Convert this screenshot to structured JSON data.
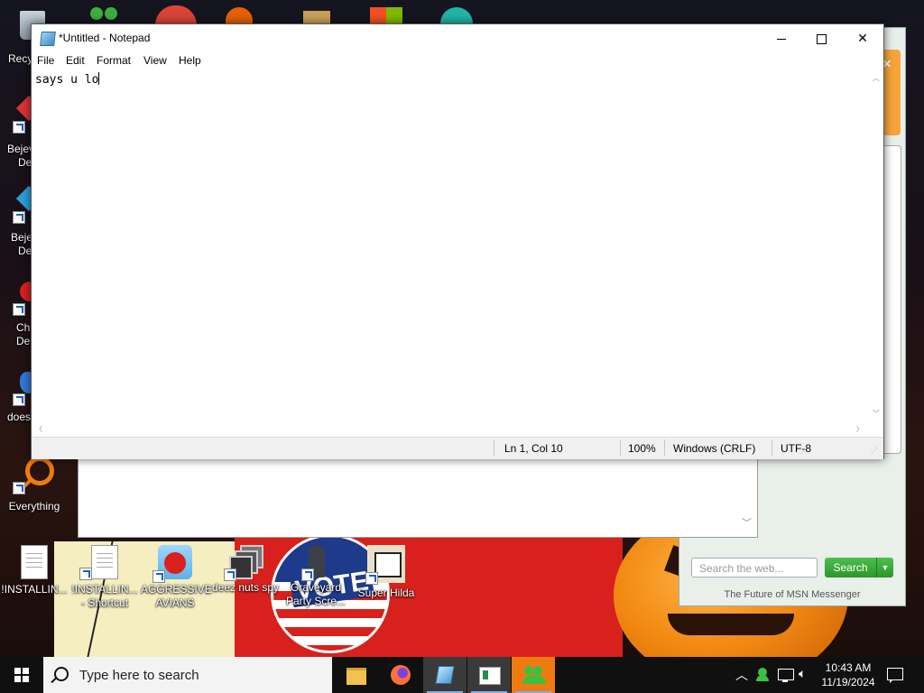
{
  "notepad": {
    "title": "*Untitled - Notepad",
    "menu": [
      "File",
      "Edit",
      "Format",
      "View",
      "Help"
    ],
    "content": "says u lo",
    "status": {
      "position": "Ln 1, Col 10",
      "zoom": "100%",
      "line_ending": "Windows (CRLF)",
      "encoding": "UTF-8"
    }
  },
  "desktop_icons": {
    "recycle_partial": "Recy",
    "bejeweled1_a": "Bejev",
    "bejeweled1_b": "De",
    "bejeweled2_a": "Beje",
    "bejeweled2_b": "De",
    "chrome_a": "Ch",
    "chrome_b": "De",
    "does": "does",
    "everything": "Everything",
    "installing1": "!INSTALLIN...",
    "installing2_a": "!INSTALLIN...",
    "installing2_b": "- Shortcut",
    "angry_a": "AGGRESSIVE",
    "angry_b": "AVIANS",
    "deez": "deez nuts spy",
    "graveyard_a": "Graveyard",
    "graveyard_b": "Party Scre...",
    "hilda": "Super Hilda"
  },
  "msn": {
    "search_placeholder": "Search the web...",
    "search_button": "Search",
    "footer": "The Future of MSN Messenger"
  },
  "wallpaper": {
    "vote_text": "VOTE"
  },
  "taskbar": {
    "search_placeholder": "Type here to search",
    "time": "10:43 AM",
    "date": "11/19/2024"
  }
}
